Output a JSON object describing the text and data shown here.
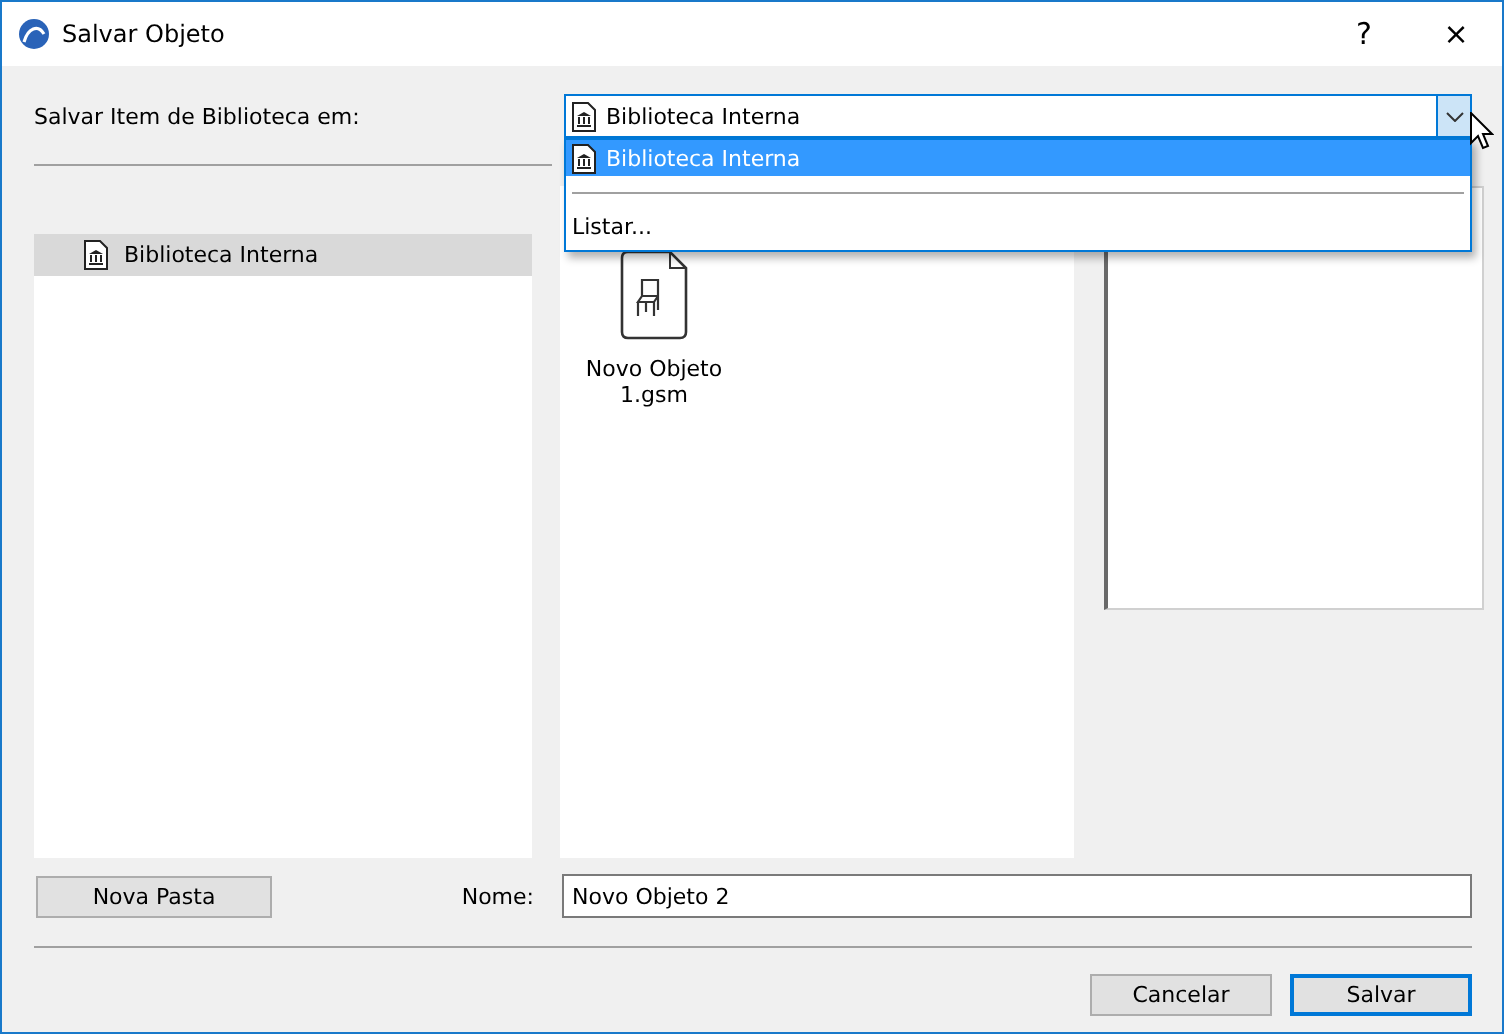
{
  "window": {
    "title": "Salvar Objeto",
    "help": "?",
    "close": "×"
  },
  "location": {
    "label": "Salvar Item de Biblioteca em:",
    "value": "Biblioteca Interna",
    "expanded": true,
    "options": [
      {
        "label": "Biblioteca Interna",
        "kind": "library",
        "selected": true
      },
      {
        "label": "Listar...",
        "kind": "action",
        "selected": false
      }
    ]
  },
  "libraries": [
    {
      "label": "Biblioteca Interna",
      "selected": true
    }
  ],
  "files": [
    {
      "name": "Novo Objeto 1.gsm"
    }
  ],
  "name_field": {
    "label": "Nome:",
    "value": "Novo Objeto 2"
  },
  "new_folder_button": "Nova Pasta",
  "buttons": [
    {
      "label": "Cancelar",
      "default": false
    },
    {
      "label": "Salvar",
      "default": true
    }
  ]
}
